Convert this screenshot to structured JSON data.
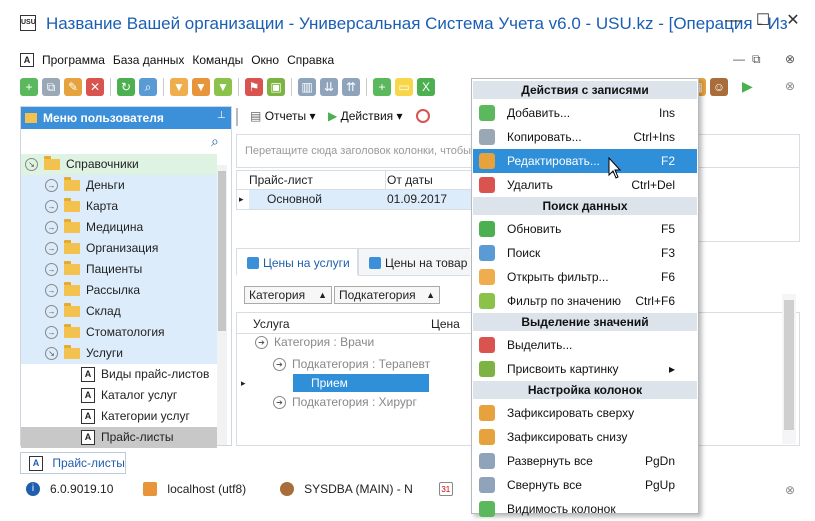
{
  "window": {
    "title": "Название Вашей организации - Универсальная Система Учета v6.0 - USU.kz - [Операция - Из",
    "app_icon_text": "USU",
    "minimize": "—",
    "maximize": "☐",
    "close": "✕"
  },
  "menu": {
    "items": [
      "Программа",
      "База данных",
      "Команды",
      "Окно",
      "Справка"
    ],
    "doc_icon": "A",
    "mdi_minimize": "—",
    "mdi_restore": "⧉",
    "mdi_close": "⊗"
  },
  "left_panel": {
    "header": "Меню пользователя",
    "pin": "📌",
    "tree": [
      {
        "label": "Справочники",
        "type": "folder-open",
        "level": 0
      },
      {
        "label": "Деньги",
        "type": "folder",
        "level": 1
      },
      {
        "label": "Карта",
        "type": "folder",
        "level": 1
      },
      {
        "label": "Медицина",
        "type": "folder",
        "level": 1
      },
      {
        "label": "Организация",
        "type": "folder",
        "level": 1
      },
      {
        "label": "Пациенты",
        "type": "folder",
        "level": 1
      },
      {
        "label": "Рассылка",
        "type": "folder",
        "level": 1
      },
      {
        "label": "Склад",
        "type": "folder",
        "level": 1
      },
      {
        "label": "Стоматология",
        "type": "folder",
        "level": 1
      },
      {
        "label": "Услуги",
        "type": "folder-open",
        "level": 1
      },
      {
        "label": "Виды прайс-листов",
        "type": "doc",
        "level": 2
      },
      {
        "label": "Каталог услуг",
        "type": "doc",
        "level": 2
      },
      {
        "label": "Категории услуг",
        "type": "doc",
        "level": 2
      },
      {
        "label": "Прайс-листы",
        "type": "doc",
        "level": 2
      }
    ]
  },
  "bottom_tab": {
    "label": "Прайс-листы",
    "icon": "A"
  },
  "status_bar": {
    "version": "6.0.9019.10",
    "server": "localhost (utf8)",
    "user": "SYSDBA (MAIN) - N",
    "calendar_icon": "31"
  },
  "main": {
    "reports_button": "Отчеты",
    "actions_button": "Действия",
    "group_hint": "Перетащите сюда заголовок колонки, чтобы сгруппировать по этой колонке",
    "pricelist_grid": {
      "headers": [
        "Прайс-лист",
        "От даты"
      ],
      "rows": [
        [
          "Основной",
          "01.09.2017"
        ]
      ]
    },
    "tabs": [
      "Цены на услуги",
      "Цены на товар"
    ],
    "group_chips": [
      "Категория",
      "Подкатегория"
    ],
    "services_grid": {
      "headers": [
        "Услуга",
        "Цена"
      ],
      "group1": "Категория : Врачи",
      "group2": "Подкатегория : Терапевт",
      "row": "Прием",
      "group3": "Подкатегория : Хирург"
    }
  },
  "context_menu": {
    "sections": [
      {
        "header": "Действия с записями",
        "items": [
          {
            "label": "Добавить...",
            "shortcut": "Ins",
            "icon": "add-icon"
          },
          {
            "label": "Копировать...",
            "shortcut": "Ctrl+Ins",
            "icon": "copy-icon"
          },
          {
            "label": "Редактировать...",
            "shortcut": "F2",
            "icon": "edit-icon",
            "highlighted": true
          },
          {
            "label": "Удалить",
            "shortcut": "Ctrl+Del",
            "icon": "delete-icon"
          }
        ]
      },
      {
        "header": "Поиск данных",
        "items": [
          {
            "label": "Обновить",
            "shortcut": "F5",
            "icon": "refresh-icon"
          },
          {
            "label": "Поиск",
            "shortcut": "F3",
            "icon": "search-icon"
          },
          {
            "label": "Открыть фильтр...",
            "shortcut": "F6",
            "icon": "filter-icon"
          },
          {
            "label": "Фильтр по значению",
            "shortcut": "Ctrl+F6",
            "icon": "filter-value-icon"
          }
        ]
      },
      {
        "header": "Выделение значений",
        "items": [
          {
            "label": "Выделить...",
            "shortcut": "",
            "icon": "flag-icon"
          },
          {
            "label": "Присвоить картинку",
            "shortcut": "▸",
            "icon": "picture-icon"
          }
        ]
      },
      {
        "header": "Настройка колонок",
        "items": [
          {
            "label": "Зафиксировать сверху",
            "shortcut": "",
            "icon": "pin-top-icon"
          },
          {
            "label": "Зафиксировать снизу",
            "shortcut": "",
            "icon": "pin-bottom-icon"
          },
          {
            "label": "Развернуть все",
            "shortcut": "PgDn",
            "icon": "expand-all-icon"
          },
          {
            "label": "Свернуть все",
            "shortcut": "PgUp",
            "icon": "collapse-all-icon"
          },
          {
            "label": "Видимость колонок",
            "shortcut": "",
            "icon": "columns-icon"
          }
        ]
      }
    ]
  },
  "colors": {
    "accent": "#3c8fd9",
    "highlight": "#2f8fd9",
    "title": "#1a5fb4",
    "tree_green": "#dff3e3",
    "tree_blue": "#dcecfb"
  }
}
